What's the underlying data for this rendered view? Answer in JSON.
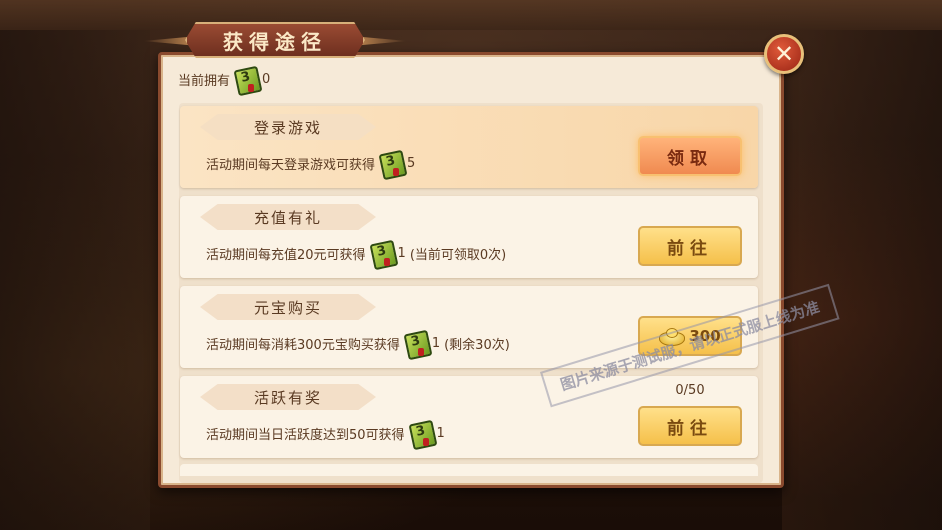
{
  "dialog": {
    "title": "获得途径",
    "close_icon": "close-icon"
  },
  "owned": {
    "label": "当前拥有",
    "count": "0"
  },
  "tasks": [
    {
      "title": "登录游戏",
      "desc_prefix": "活动期间每天登录游戏可获得",
      "reward": "5",
      "extra": "",
      "button": "领取",
      "button_type": "claim"
    },
    {
      "title": "充值有礼",
      "desc_prefix": "活动期间每充值20元可获得",
      "reward": "1",
      "extra": "(当前可领取0次)",
      "button": "前往",
      "button_type": "go"
    },
    {
      "title": "元宝购买",
      "desc_prefix": "活动期间每消耗300元宝购买获得",
      "reward": "1",
      "extra": "(剩余30次)",
      "button": "300",
      "button_type": "ingot"
    },
    {
      "title": "活跃有奖",
      "desc_prefix": "活动期间当日活跃度达到50可获得",
      "reward": "1",
      "extra": "",
      "button": "前往",
      "button_type": "go",
      "progress": "0/50"
    }
  ],
  "watermark": "图片来源于测试服，请以正式服上线为准",
  "colors": {
    "panel_bg": "#f6ead8",
    "claim_button": "#f08a50",
    "go_button": "#f5c04a",
    "title_banner": "#8a3e28"
  }
}
